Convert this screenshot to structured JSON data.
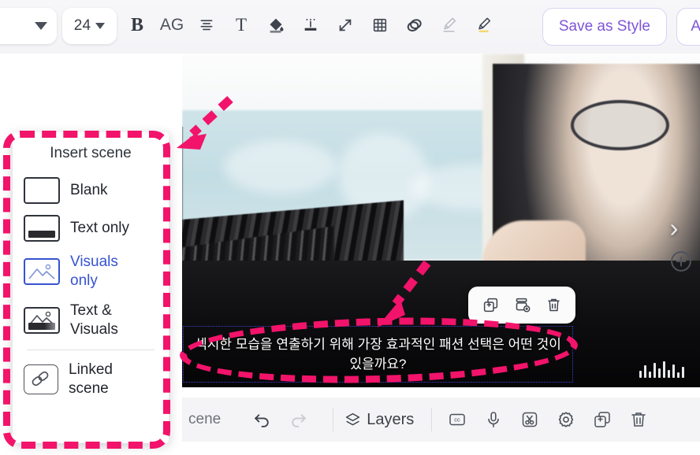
{
  "app": {
    "accent_purple": "#7f55d8",
    "annotation_pink": "#f2136a",
    "selected_blue": "#3653cf"
  },
  "toolbar": {
    "font_family_value": "..",
    "font_size_value": "24",
    "icons": [
      {
        "name": "bold-icon",
        "glyph": "B"
      },
      {
        "name": "font-case-icon",
        "glyph": "AG"
      },
      {
        "name": "text-align-icon",
        "glyph": ""
      },
      {
        "name": "text-style-icon",
        "glyph": "T"
      },
      {
        "name": "fill-color-icon",
        "glyph": ""
      },
      {
        "name": "text-background-icon",
        "glyph": ""
      },
      {
        "name": "resize-icon",
        "glyph": ""
      },
      {
        "name": "grid-icon",
        "glyph": ""
      },
      {
        "name": "opacity-icon",
        "glyph": ""
      },
      {
        "name": "highlighter-off-icon",
        "glyph": ""
      },
      {
        "name": "highlighter-on-icon",
        "glyph": ""
      }
    ],
    "save_as_style_label": "Save as Style",
    "apply_label": "Ap"
  },
  "insert_scene_menu": {
    "title": "Insert scene",
    "items": [
      {
        "label": "Blank",
        "icon": "blank-scene-icon",
        "selected": false
      },
      {
        "label": "Text only",
        "icon": "text-only-scene-icon",
        "selected": false
      },
      {
        "label": "Visuals only",
        "icon": "visuals-only-scene-icon",
        "selected": true
      },
      {
        "label": "Text & Visuals",
        "icon": "text-and-visuals-scene-icon",
        "selected": false
      },
      {
        "label": "Linked scene",
        "icon": "linked-scene-icon",
        "selected": false
      }
    ]
  },
  "canvas": {
    "subtitle_text": "섹시한 모습을 연출하기 위해 가장 효과적인 패션 선택은 어떤 것이 있을까요?",
    "next_scene_glyph": "›",
    "prev_scene_glyph": "‹",
    "add_scene_glyph": "+",
    "float_toolbar": [
      {
        "name": "duplicate-element-icon"
      },
      {
        "name": "layer-add-icon"
      },
      {
        "name": "delete-element-icon"
      }
    ]
  },
  "bottom_toolbar": {
    "scene_button_label": "cene",
    "undo_label": "undo-icon",
    "redo_label": "redo-icon",
    "layers_label": "Layers",
    "tools": [
      {
        "name": "captions-icon",
        "glyph": "cc"
      },
      {
        "name": "microphone-icon",
        "glyph": ""
      },
      {
        "name": "cut-icon",
        "glyph": ""
      },
      {
        "name": "settings-gear-icon",
        "glyph": ""
      },
      {
        "name": "duplicate-scene-icon",
        "glyph": ""
      },
      {
        "name": "delete-scene-icon",
        "glyph": ""
      }
    ]
  }
}
